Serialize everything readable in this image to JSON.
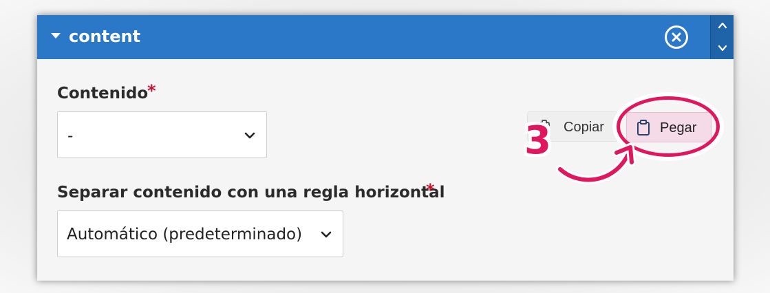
{
  "panel": {
    "title": "content",
    "header_color": "#2a78c7",
    "toggle_icon": "caret-down-icon",
    "close_icon": "circle-x-icon",
    "move_up_icon": "chevron-up-icon",
    "move_down_icon": "chevron-down-icon"
  },
  "fields": {
    "content": {
      "label": "Contenido",
      "required_mark": "*",
      "selected_value": "-"
    },
    "separator": {
      "label": "Separar contenido con una regla horizontal",
      "required_mark": "*",
      "selected_value": "Automático (predeterminado)"
    }
  },
  "actions": {
    "copy_label": "Copiar",
    "copy_icon": "clipboard-icon",
    "paste_label": "Pegar",
    "paste_icon": "paste-clipboard-icon"
  },
  "annotation": {
    "step_number": "3",
    "accent_color": "#e0165f"
  }
}
